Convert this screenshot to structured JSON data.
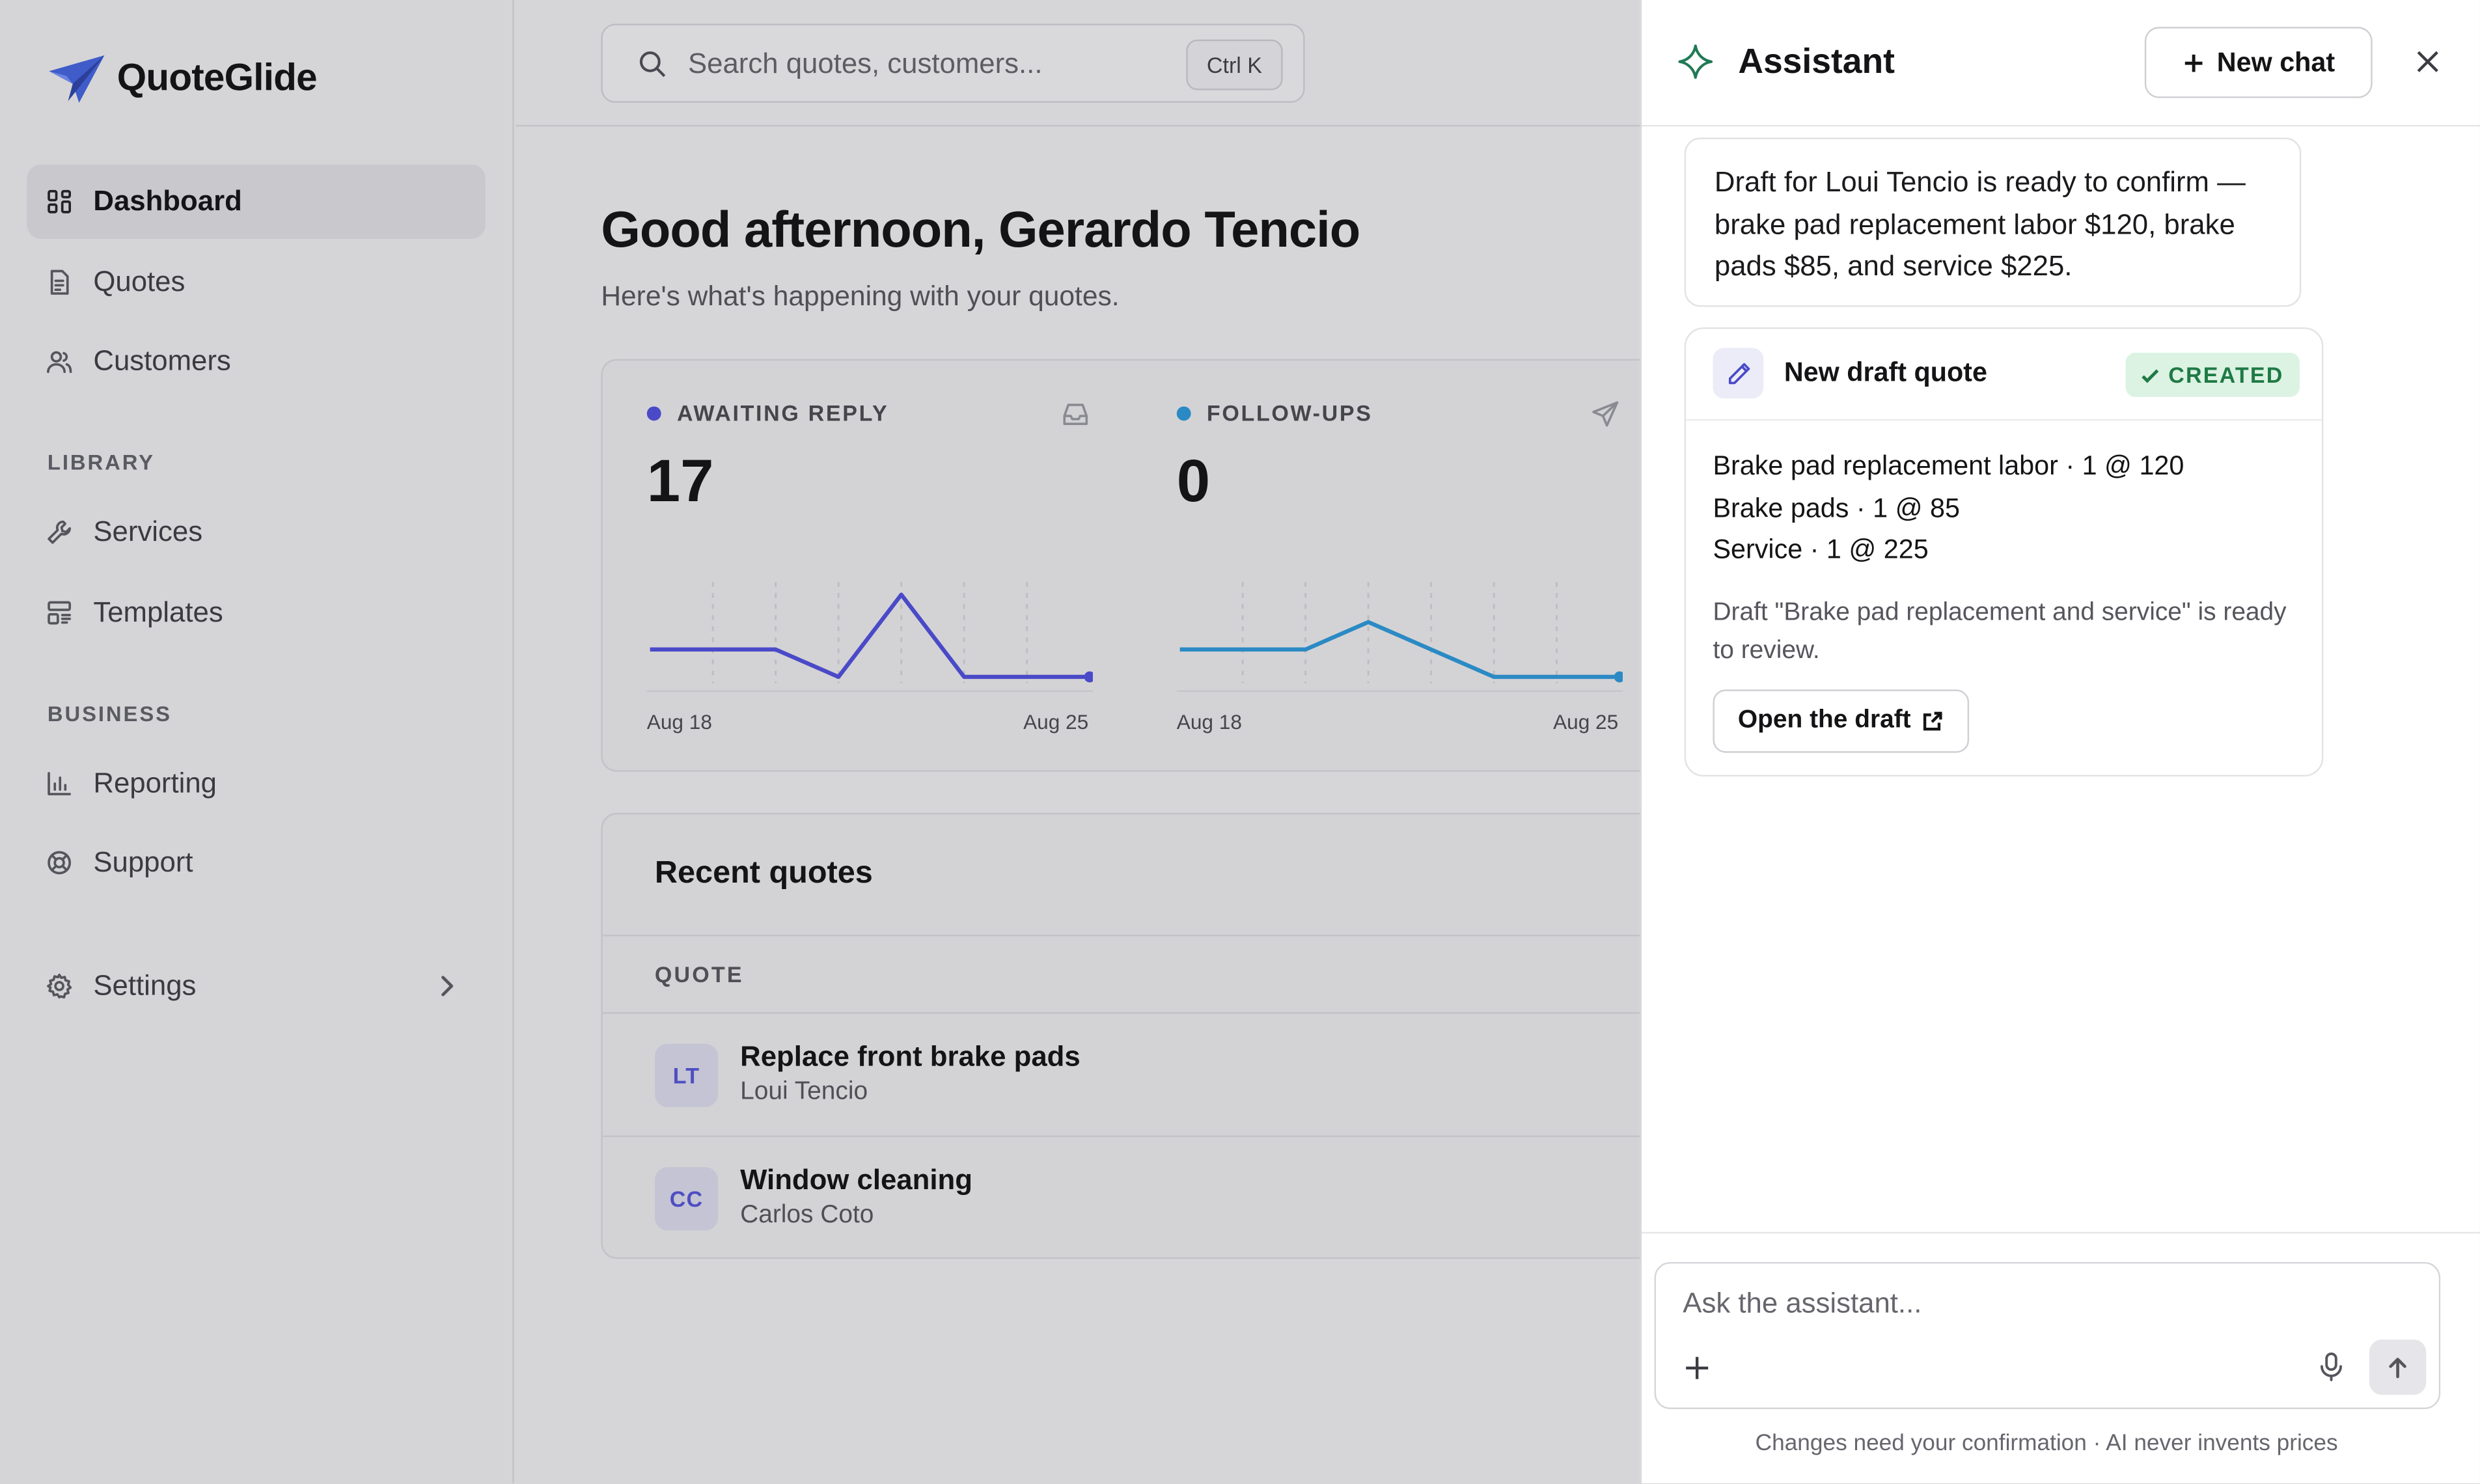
{
  "app": {
    "name": "QuoteGlide"
  },
  "sidebar": {
    "items": [
      {
        "label": "Dashboard",
        "icon": "dashboard-icon",
        "active": true
      },
      {
        "label": "Quotes",
        "icon": "document-icon"
      },
      {
        "label": "Customers",
        "icon": "users-icon"
      }
    ],
    "library_heading": "LIBRARY",
    "library_items": [
      {
        "label": "Services",
        "icon": "wrench-icon"
      },
      {
        "label": "Templates",
        "icon": "template-icon"
      }
    ],
    "business_heading": "BUSINESS",
    "business_items": [
      {
        "label": "Reporting",
        "icon": "bar-chart-icon"
      },
      {
        "label": "Support",
        "icon": "lifebuoy-icon"
      }
    ],
    "settings_label": "Settings"
  },
  "search": {
    "placeholder": "Search quotes, customers...",
    "shortcut": "Ctrl K"
  },
  "main": {
    "greeting": "Good afternoon, Gerardo Tencio",
    "subtitle": "Here's what's happening with your quotes."
  },
  "stats": [
    {
      "label": "AWAITING REPLY",
      "value": "17",
      "color": "#4a4ac8",
      "icon": "inbox-icon",
      "date_start": "Aug 18",
      "date_end": "Aug 25",
      "chart_data": {
        "type": "line",
        "x": [
          "Aug 18",
          "Aug 19",
          "Aug 20",
          "Aug 21",
          "Aug 22",
          "Aug 23",
          "Aug 24",
          "Aug 25"
        ],
        "values": [
          1,
          1,
          1,
          0,
          3,
          0,
          0,
          0
        ]
      }
    },
    {
      "label": "FOLLOW-UPS",
      "value": "0",
      "color": "#2b8ac4",
      "icon": "send-icon",
      "date_start": "Aug 18",
      "date_end": "Aug 25",
      "chart_data": {
        "type": "line",
        "x": [
          "Aug 18",
          "Aug 19",
          "Aug 20",
          "Aug 21",
          "Aug 22",
          "Aug 23",
          "Aug 24",
          "Aug 25"
        ],
        "values": [
          1,
          1,
          1,
          2,
          1,
          0,
          0,
          0
        ]
      }
    }
  ],
  "recent": {
    "title": "Recent quotes",
    "column_header": "QUOTE",
    "rows": [
      {
        "initials": "LT",
        "title": "Replace front brake pads",
        "customer": "Loui Tencio"
      },
      {
        "initials": "CC",
        "title": "Window cleaning",
        "customer": "Carlos Coto"
      }
    ]
  },
  "assistant": {
    "title": "Assistant",
    "new_chat_label": "New chat",
    "message": "Draft for Loui Tencio is ready to confirm — brake pad replacement labor $120, brake pads $85, and service $225.",
    "draft": {
      "title": "New draft quote",
      "badge": "CREATED",
      "line_items": [
        "Brake pad replacement labor · 1 @ 120",
        "Brake pads · 1 @ 85",
        "Service · 1 @ 225"
      ],
      "note": "Draft \"Brake pad replacement and service\" is ready to review.",
      "open_label": "Open the draft"
    },
    "input_placeholder": "Ask the assistant...",
    "disclaimer": "Changes need your confirmation · AI never invents prices"
  },
  "colors": {
    "accent": "#4a4ac8",
    "success": "#1f7a45",
    "brand": "#3f5cc9"
  }
}
